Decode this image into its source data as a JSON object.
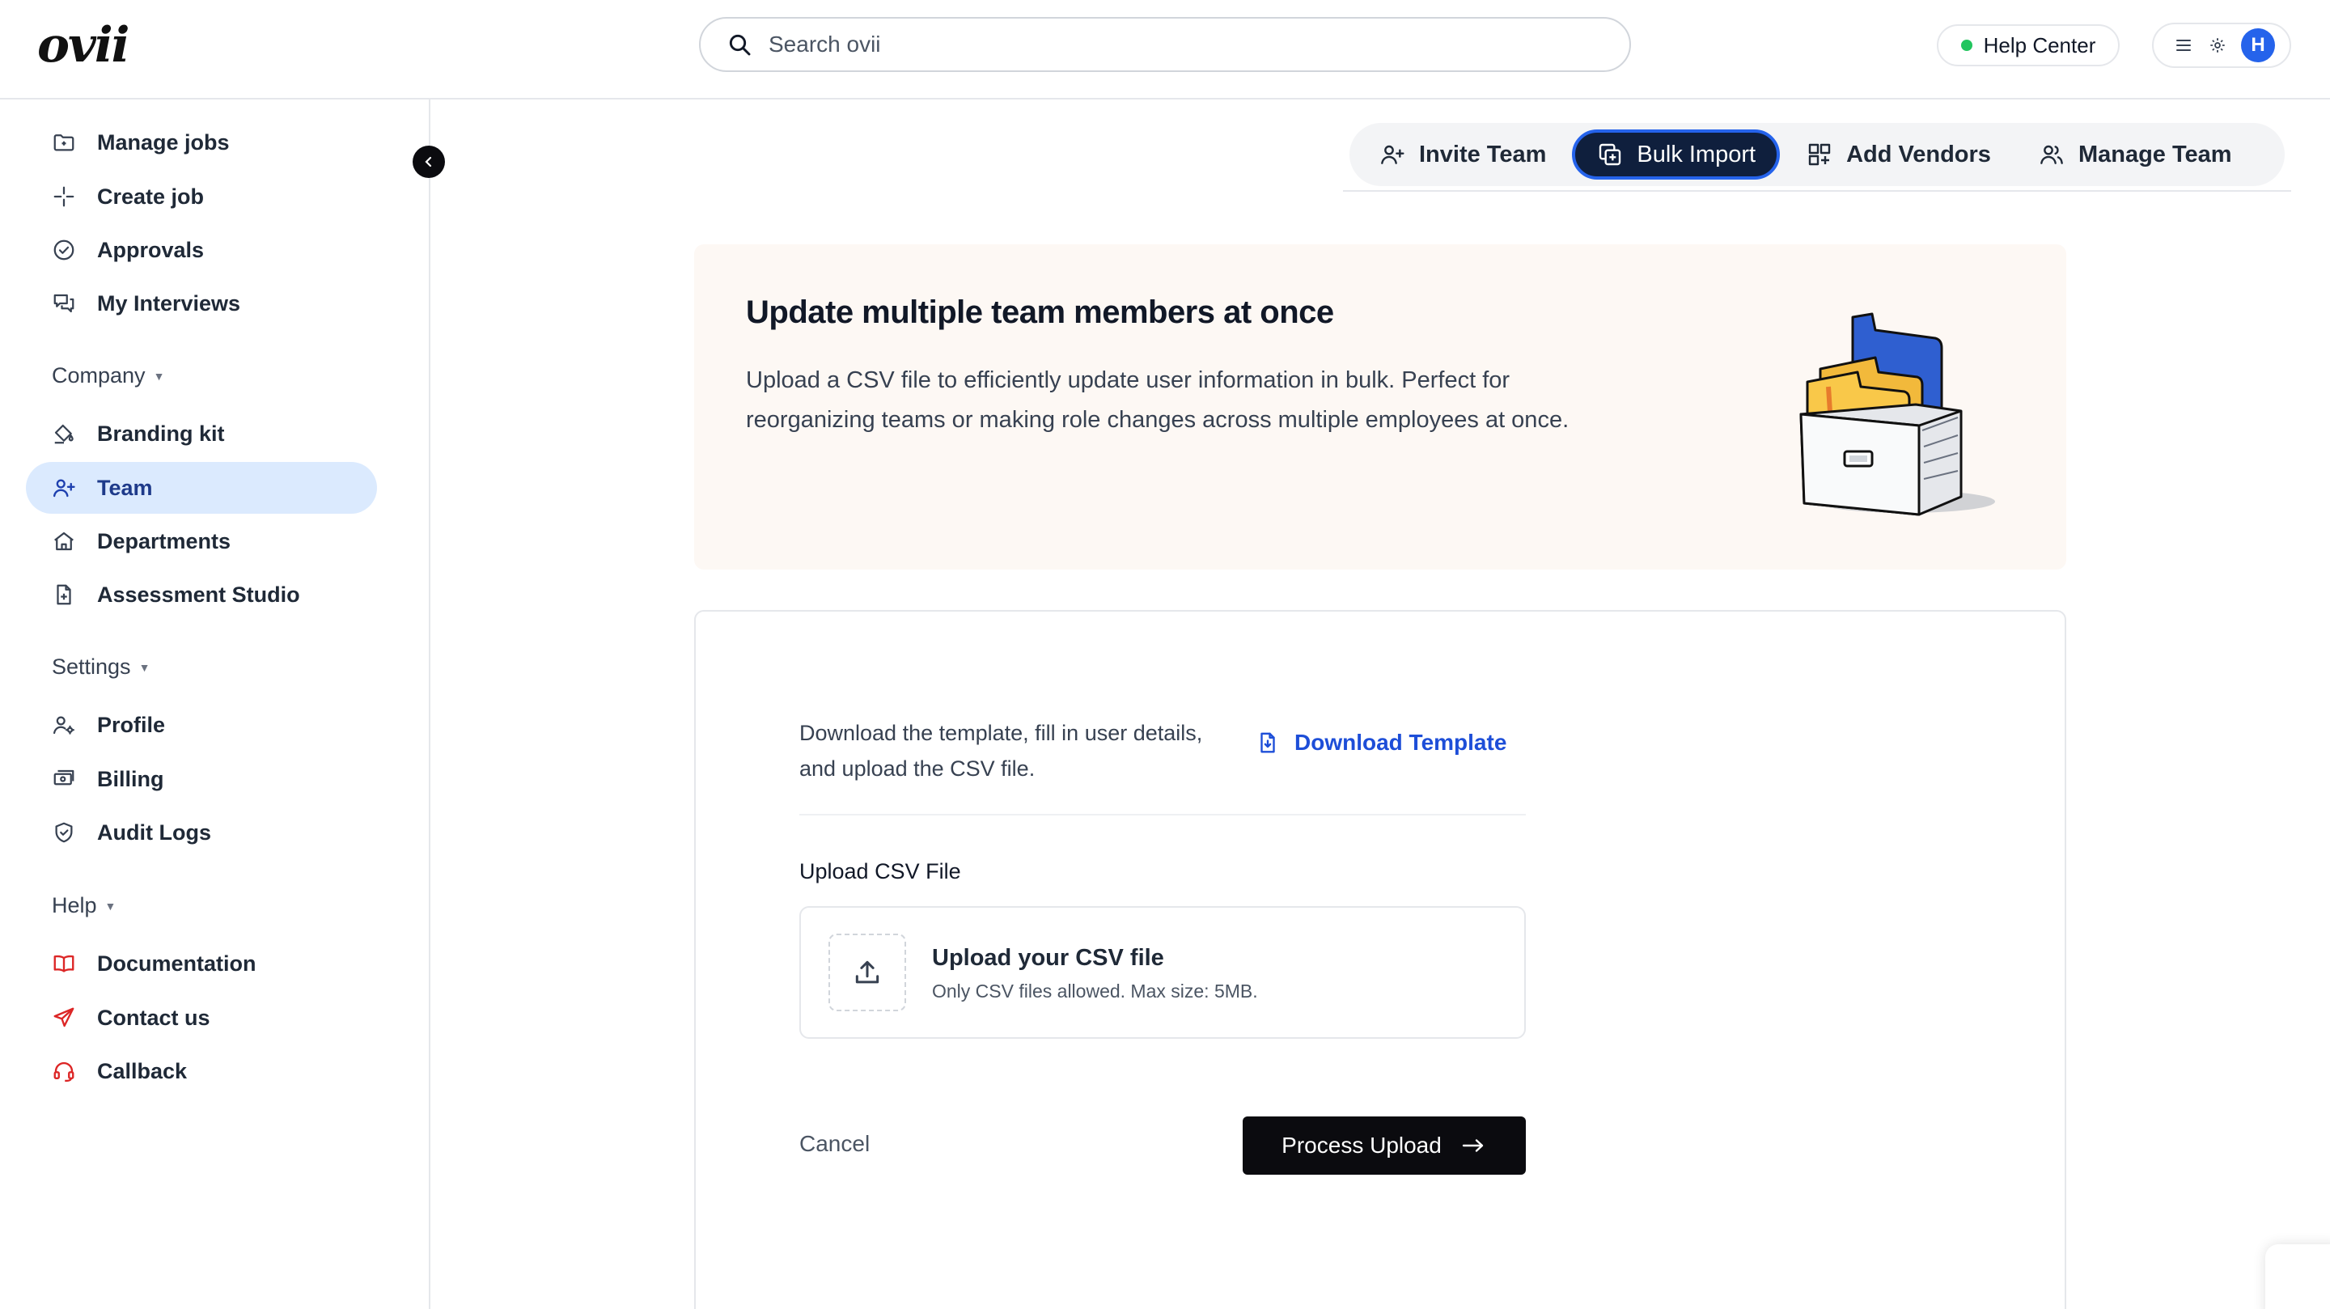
{
  "app": {
    "logo": "ovii"
  },
  "search": {
    "placeholder": "Search ovii"
  },
  "header": {
    "help_center": "Help Center",
    "avatar_initial": "H",
    "status_color": "#22c55e",
    "avatar_color": "#2563eb"
  },
  "sidebar": {
    "main_items": [
      {
        "label": "Manage jobs",
        "icon": "folder-icon"
      },
      {
        "label": "Create job",
        "icon": "sparkle-icon"
      },
      {
        "label": "Approvals",
        "icon": "check-circle-icon"
      },
      {
        "label": "My Interviews",
        "icon": "chat-bubbles-icon"
      }
    ],
    "company": {
      "heading": "Company",
      "items": [
        {
          "label": "Branding kit",
          "icon": "paint-bucket-icon"
        },
        {
          "label": "Team",
          "icon": "user-plus-icon",
          "active": true
        },
        {
          "label": "Departments",
          "icon": "building-icon"
        },
        {
          "label": "Assessment Studio",
          "icon": "document-plus-icon"
        }
      ]
    },
    "settings": {
      "heading": "Settings",
      "items": [
        {
          "label": "Profile",
          "icon": "user-gear-icon"
        },
        {
          "label": "Billing",
          "icon": "billing-icon"
        },
        {
          "label": "Audit Logs",
          "icon": "shield-icon"
        }
      ]
    },
    "help": {
      "heading": "Help",
      "items": [
        {
          "label": "Documentation",
          "icon": "book-icon"
        },
        {
          "label": "Contact us",
          "icon": "send-icon"
        },
        {
          "label": "Callback",
          "icon": "headset-icon"
        }
      ]
    }
  },
  "tabs": [
    {
      "label": "Invite Team",
      "icon": "user-plus-icon"
    },
    {
      "label": "Bulk Import",
      "icon": "copy-plus-icon",
      "active": true
    },
    {
      "label": "Add Vendors",
      "icon": "grid-plus-icon"
    },
    {
      "label": "Manage Team",
      "icon": "users-icon"
    }
  ],
  "hero": {
    "title": "Update multiple team members at once",
    "description": "Upload a CSV file to efficiently update user information in bulk. Perfect for reorganizing teams or making role changes across multiple employees at once."
  },
  "import_card": {
    "instructions": "Download the template, fill in user details, and upload the CSV file.",
    "download_label": "Download Template",
    "upload_label": "Upload CSV File",
    "dropzone_title": "Upload your CSV file",
    "dropzone_hint": "Only CSV files allowed. Max size: 5MB.",
    "cancel_label": "Cancel",
    "process_label": "Process Upload"
  },
  "colors": {
    "accent": "#1d4ed8",
    "active_nav_bg": "#dbeafe",
    "active_tab_bg": "#0f1f3d",
    "hero_bg": "#fdf8f4"
  }
}
